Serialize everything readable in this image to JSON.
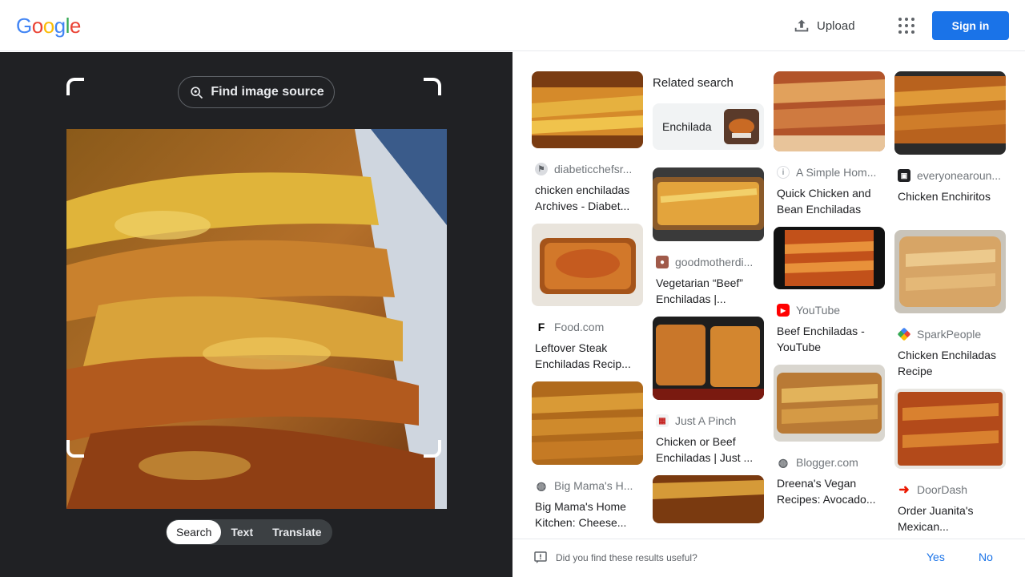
{
  "header": {
    "logo": [
      "G",
      "o",
      "o",
      "g",
      "l",
      "e"
    ],
    "logo_colors": [
      "#4285F4",
      "#EA4335",
      "#FBBC05",
      "#4285F4",
      "#34A853",
      "#EA4335"
    ],
    "upload_label": "Upload",
    "signin_label": "Sign in"
  },
  "lens": {
    "find_source_label": "Find image source",
    "modes": [
      "Search",
      "Text",
      "Translate"
    ],
    "active_mode": "Search"
  },
  "related": {
    "heading": "Related search",
    "chip": "Enchilada"
  },
  "results": {
    "col1": [
      {
        "source": "diabeticchefsr...",
        "title": "chicken enchiladas Archives - Diabet..."
      },
      {
        "source": "Food.com",
        "title": "Leftover Steak Enchiladas Recip..."
      },
      {
        "source": "Big Mama's H...",
        "title": "Big Mama's Home Kitchen: Cheese..."
      }
    ],
    "col2": [
      {
        "source": "goodmotherdi...",
        "title": "Vegetarian “Beef” Enchiladas |..."
      },
      {
        "source": "Just A Pinch",
        "title": "Chicken or Beef Enchiladas | Just ..."
      }
    ],
    "col3": [
      {
        "source": "A Simple Hom...",
        "title": "Quick Chicken and Bean Enchiladas"
      },
      {
        "source": "YouTube",
        "title": "Beef Enchiladas - YouTube"
      },
      {
        "source": "Blogger.com",
        "title": "Dreena's Vegan Recipes: Avocado..."
      }
    ],
    "col4": [
      {
        "source": "everyonearoun...",
        "title": "Chicken Enchiritos"
      },
      {
        "source": "SparkPeople",
        "title": "Chicken Enchiladas Recipe"
      },
      {
        "source": "DoorDash",
        "title": "Order Juanita's Mexican..."
      }
    ]
  },
  "feedback": {
    "question": "Did you find these results useful?",
    "yes": "Yes",
    "no": "No"
  },
  "colors": {
    "accent": "#1a73e8",
    "dark_panel": "#202124"
  }
}
